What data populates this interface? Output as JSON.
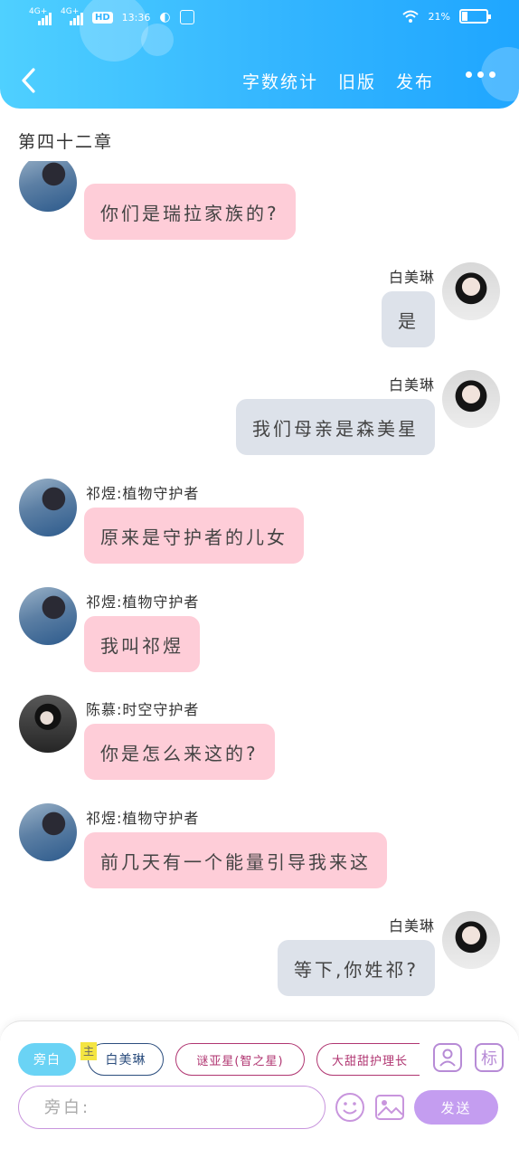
{
  "status_bar": {
    "signal_1": "4G+",
    "signal_2": "4G+",
    "hd": "HD",
    "time": "13:36",
    "battery": "21%"
  },
  "nav": {
    "word_count": "字数统计",
    "old_version": "旧版",
    "publish": "发布"
  },
  "chapter_title": "第四十二章",
  "messages": [
    {
      "side": "left",
      "avatar": "boy",
      "text": "你们是瑞拉家族的?"
    },
    {
      "side": "right",
      "name": "白美琳",
      "text": "是"
    },
    {
      "side": "right",
      "name": "白美琳",
      "text": "我们母亲是森美星"
    },
    {
      "side": "left",
      "avatar": "boy",
      "name": "祁煜:植物守护者",
      "text": "原来是守护者的儿女"
    },
    {
      "side": "left",
      "avatar": "boy",
      "name": "祁煜:植物守护者",
      "text": "我叫祁煜"
    },
    {
      "side": "left",
      "avatar": "dark",
      "name": "陈慕:时空守护者",
      "text": "你是怎么来这的?"
    },
    {
      "side": "left",
      "avatar": "boy",
      "name": "祁煜:植物守护者",
      "text": "前几天有一个能量引导我来这"
    },
    {
      "side": "right",
      "name": "白美琳",
      "text": "等下,你姓祁?"
    }
  ],
  "bottom_panel": {
    "narration_chip": "旁白",
    "main_tag": "主",
    "roles": [
      "白美琳",
      "谜亚星(智之星)",
      "大甜甜护理长"
    ],
    "role_icon": "person-card-icon",
    "mark_label": "标",
    "input_placeholder": "旁白:",
    "emoji_icon": "smiley-icon",
    "image_icon": "image-icon",
    "send_label": "发送"
  },
  "colors": {
    "header": "#33b5ff",
    "left_bubble": "#fecdd8",
    "right_bubble": "#dde2ea",
    "accent_purple": "#c49df0"
  }
}
